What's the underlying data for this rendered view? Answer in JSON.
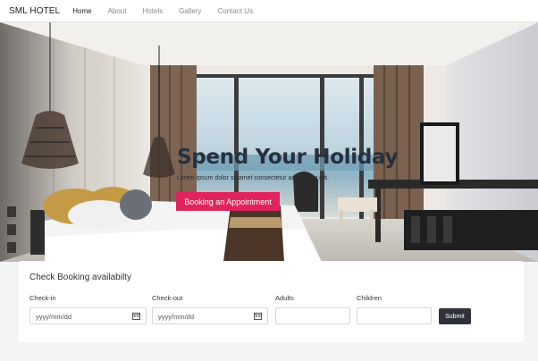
{
  "nav": {
    "brand": "SML HOTEL",
    "links": [
      "Home",
      "About",
      "Hotels",
      "Gallery",
      "Contact Us"
    ],
    "active": "Home"
  },
  "hero": {
    "title": "Spend Your Holiday",
    "subtitle": "Lorem ipsum dolor sit amet consectetur adipisicing elit.",
    "button_label": "Booking an Appointment",
    "button_color": "#e0245e"
  },
  "booking": {
    "title": "Check Booking availabilty",
    "checkin_label": "Check-in",
    "checkin_value": "yyyy/mm/dd",
    "checkout_label": "Check-out",
    "checkout_value": "yyyy/mm/dd",
    "adults_label": "Adults",
    "children_label": "Children",
    "submit_label": "Submit"
  }
}
